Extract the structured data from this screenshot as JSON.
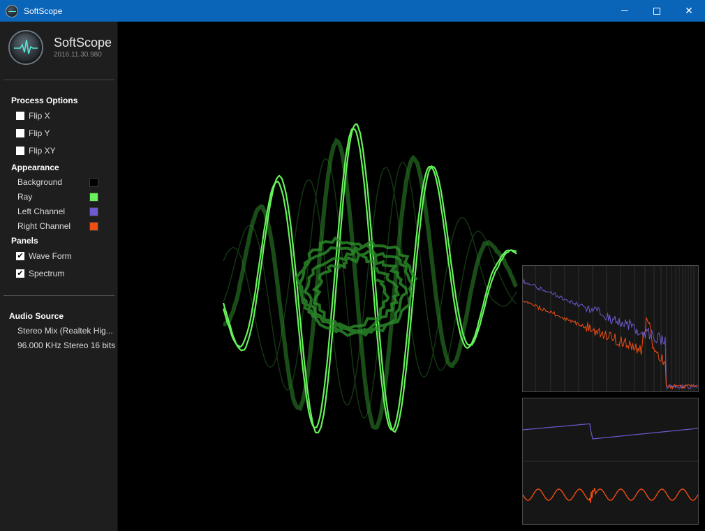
{
  "window": {
    "title": "SoftScope",
    "minimize_icon": "minimize-icon",
    "maximize_icon": "maximize-icon",
    "close_icon": "close-icon",
    "close_glyph": "✕"
  },
  "brand": {
    "name": "SoftScope",
    "version": "2016.11.30.980"
  },
  "process_options": {
    "title": "Process Options",
    "items": [
      {
        "label": "Flip X",
        "checked": false
      },
      {
        "label": "Flip Y",
        "checked": false
      },
      {
        "label": "Flip XY",
        "checked": false
      }
    ]
  },
  "appearance": {
    "title": "Appearance",
    "items": [
      {
        "label": "Background",
        "color": "#000000"
      },
      {
        "label": "Ray",
        "color": "#66f25a"
      },
      {
        "label": "Left Channel",
        "color": "#6b5ad0"
      },
      {
        "label": "Right Channel",
        "color": "#f04d12"
      }
    ]
  },
  "panels": {
    "title": "Panels",
    "items": [
      {
        "label": "Wave Form",
        "checked": true,
        "glyph": "✔"
      },
      {
        "label": "Spectrum",
        "checked": true,
        "glyph": "✔"
      }
    ]
  },
  "audio_source": {
    "title": "Audio Source",
    "device": "Stereo Mix (Realtek Hig...",
    "format": "96.000 KHz Stereo 16 bits"
  },
  "colors": {
    "ray": "#66f25a",
    "left_channel": "#6b5ad0",
    "right_channel": "#f04d12",
    "titlebar": "#0a64b8"
  }
}
